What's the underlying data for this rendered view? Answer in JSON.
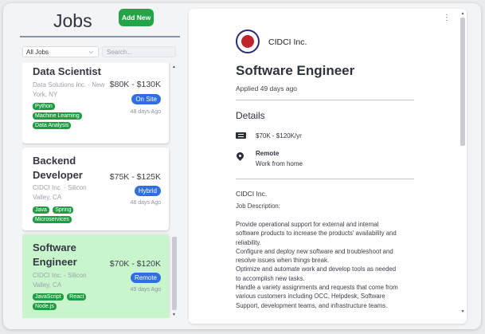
{
  "header": {
    "title": "Jobs",
    "add_button": "Add New"
  },
  "filters": {
    "select_value": "All Jobs",
    "search_placeholder": "Search..."
  },
  "jobs": [
    {
      "title": "Data Scientist",
      "company": "Data Solutions Inc. - New York, NY",
      "salary": "$80K - $130K",
      "mode": "On Site",
      "posted": "48 days Ago",
      "tags": [
        "Python",
        "Machine Learning",
        "Data Analysis"
      ]
    },
    {
      "title": "Backend Developer",
      "company": "CIDCI Inc. - Silicon Valley, CA",
      "salary": "$75K - $125K",
      "mode": "Hybrid",
      "posted": "48 days Ago",
      "tags": [
        "Java",
        "Spring",
        "Microservices"
      ]
    },
    {
      "title": "Software Engineer",
      "company": "CIDCI Inc. - Silicon Valley, CA",
      "salary": "$70K - $120K",
      "mode": "Remote",
      "posted": "49 days Ago",
      "tags": [
        "JavaScript",
        "React",
        "Node.js"
      ]
    }
  ],
  "detail": {
    "company": "CIDCI Inc.",
    "title": "Software Engineer",
    "applied": "Applied 49 days ago",
    "details_heading": "Details",
    "salary": "$70K - $120K/yr",
    "location_type": "Remote",
    "location_desc": "Work from home",
    "desc_company": "CIDCI Inc.",
    "desc_label": "Job Description:",
    "desc_lines": [
      "Provide operational support for external and internal",
      "software products to increase the products' availability and",
      "reliability.",
      "Configure and deploy new software and troubleshoot and",
      "resolve issues when things break.",
      "Optimize and automate work and develop tools as needed",
      "to accomplish new tasks.",
      "Handle a variety assignments and requests that come from",
      "various customers including OCC, Helpdesk, Software",
      "Support, development teams, and infrastructure teams."
    ]
  },
  "icons": {
    "kebab": "more-vertical-icon",
    "money": "money-icon",
    "location": "location-pin-icon",
    "chevron": "chevron-down-icon"
  },
  "colors": {
    "add_button": "#22a447",
    "tag": "#1f9d43",
    "badge": "#2f6fe0",
    "active_card": "#c9f5cd"
  }
}
